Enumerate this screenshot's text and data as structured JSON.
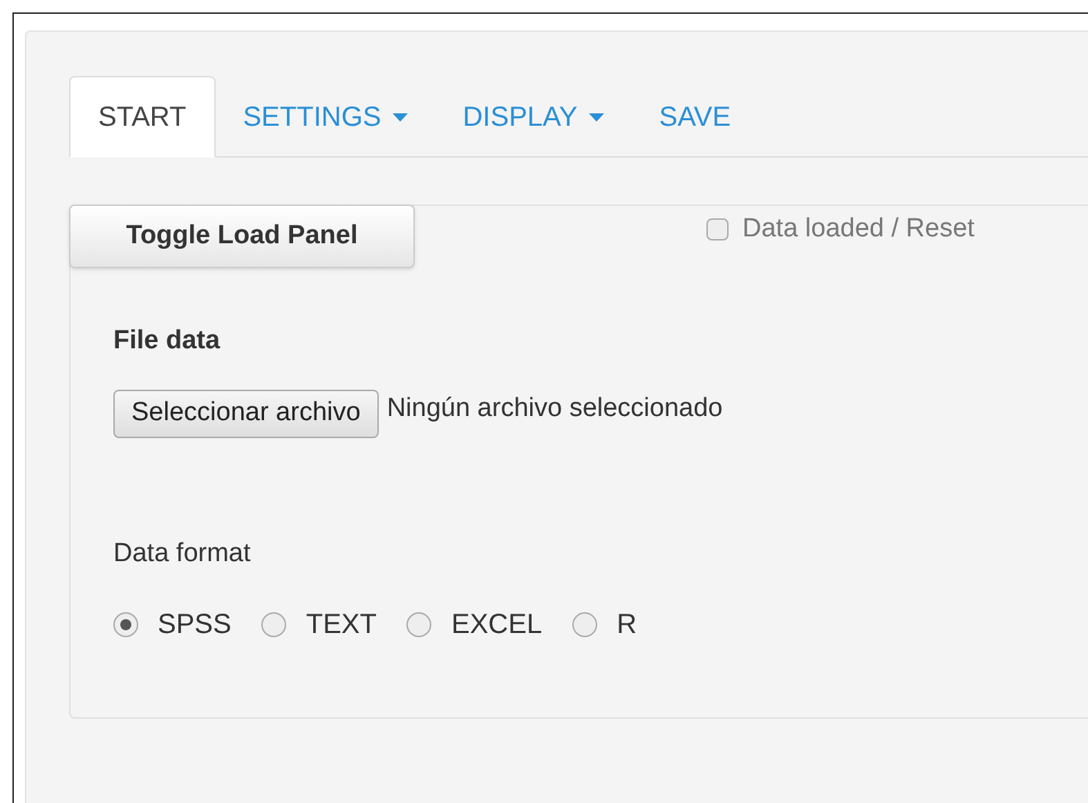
{
  "tabs": [
    {
      "label": "START",
      "selected": true,
      "dropdown": false
    },
    {
      "label": "SETTINGS",
      "selected": false,
      "dropdown": true
    },
    {
      "label": "DISPLAY",
      "selected": false,
      "dropdown": true
    },
    {
      "label": "SAVE",
      "selected": false,
      "dropdown": false
    }
  ],
  "toggle_button": "Toggle Load Panel",
  "data_loaded": {
    "label": "Data loaded / Reset",
    "checked": false
  },
  "file_data": {
    "heading": "File data",
    "button": "Seleccionar archivo",
    "status": "Ningún archivo seleccionado"
  },
  "data_format": {
    "label": "Data format",
    "options": [
      {
        "label": "SPSS",
        "selected": true
      },
      {
        "label": "TEXT",
        "selected": false
      },
      {
        "label": "EXCEL",
        "selected": false
      },
      {
        "label": "R",
        "selected": false
      }
    ]
  }
}
